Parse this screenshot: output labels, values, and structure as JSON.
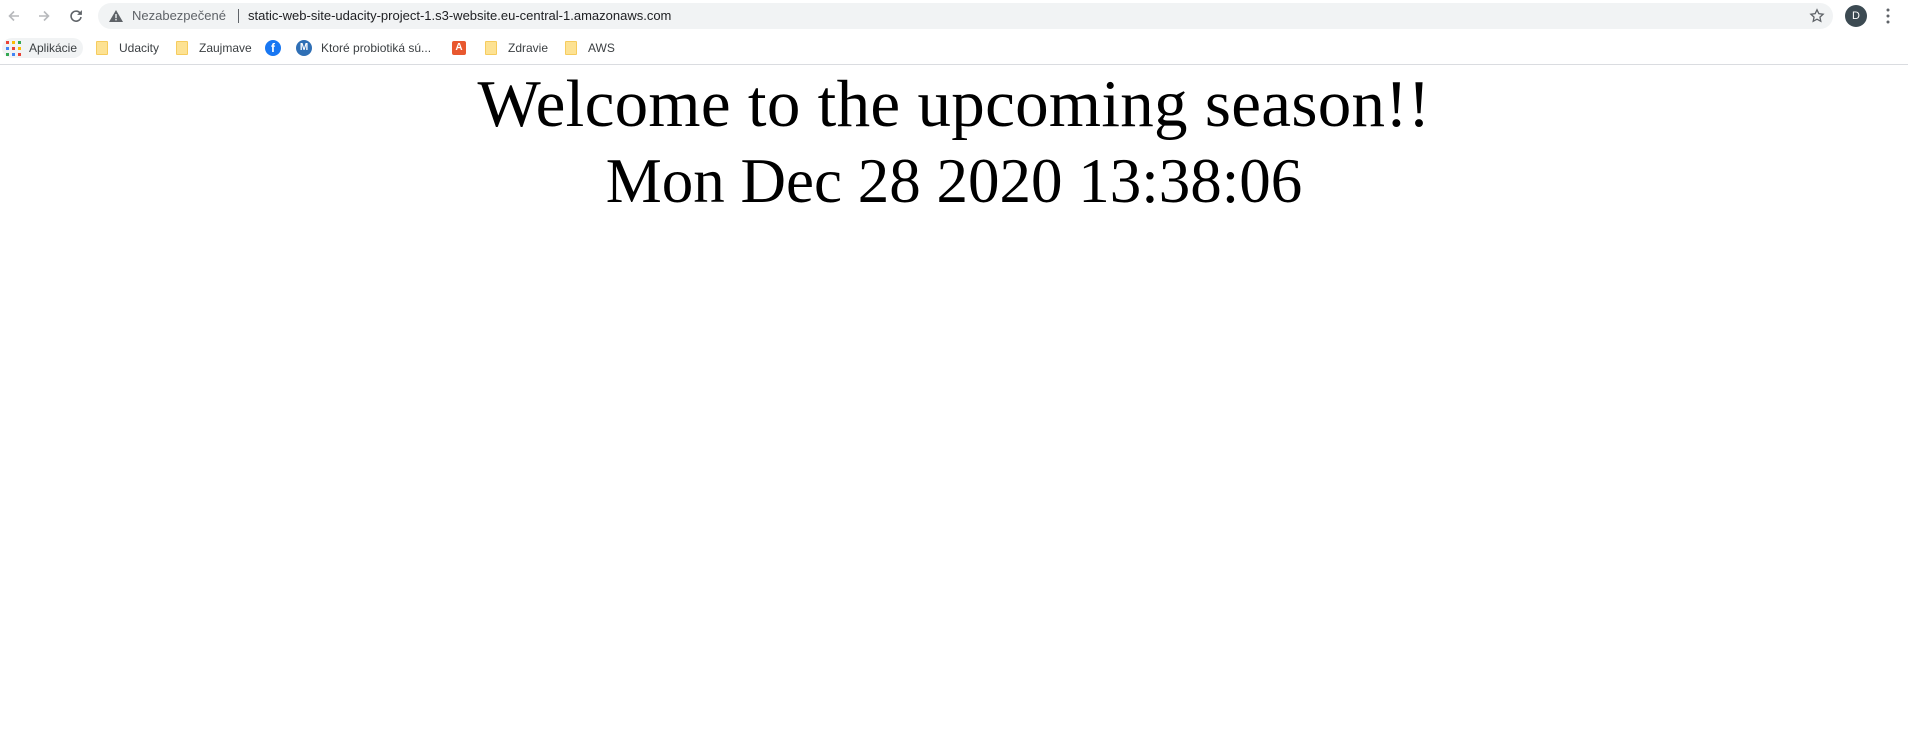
{
  "toolbar": {
    "back_icon": "arrow-left-icon",
    "forward_icon": "arrow-right-icon",
    "reload_icon": "reload-icon",
    "security_label": "Nezabezpečené",
    "url": "static-web-site-udacity-project-1.s3-website.eu-central-1.amazonaws.com",
    "profile_initial": "D"
  },
  "bookmarks": [
    {
      "label": "Aplikácie",
      "icon": "apps-grid-icon"
    },
    {
      "label": "Udacity",
      "icon": "folder-icon"
    },
    {
      "label": "Zaujmave",
      "icon": "folder-icon"
    },
    {
      "label": "",
      "icon": "facebook-icon"
    },
    {
      "label": "Ktoré probiotiká sú...",
      "icon": "m-site-icon"
    },
    {
      "label": "",
      "icon": "a-site-icon"
    },
    {
      "label": "Zdravie",
      "icon": "folder-icon"
    },
    {
      "label": "AWS",
      "icon": "folder-icon"
    }
  ],
  "page": {
    "headline": "Welcome to the upcoming season!!",
    "datetime": "Mon Dec 28 2020 13:38:06"
  },
  "colors": {
    "omnibox_bg": "#f1f3f4",
    "folder": "#fde293",
    "facebook": "#1877f2",
    "avatar": "#3c4a52"
  }
}
